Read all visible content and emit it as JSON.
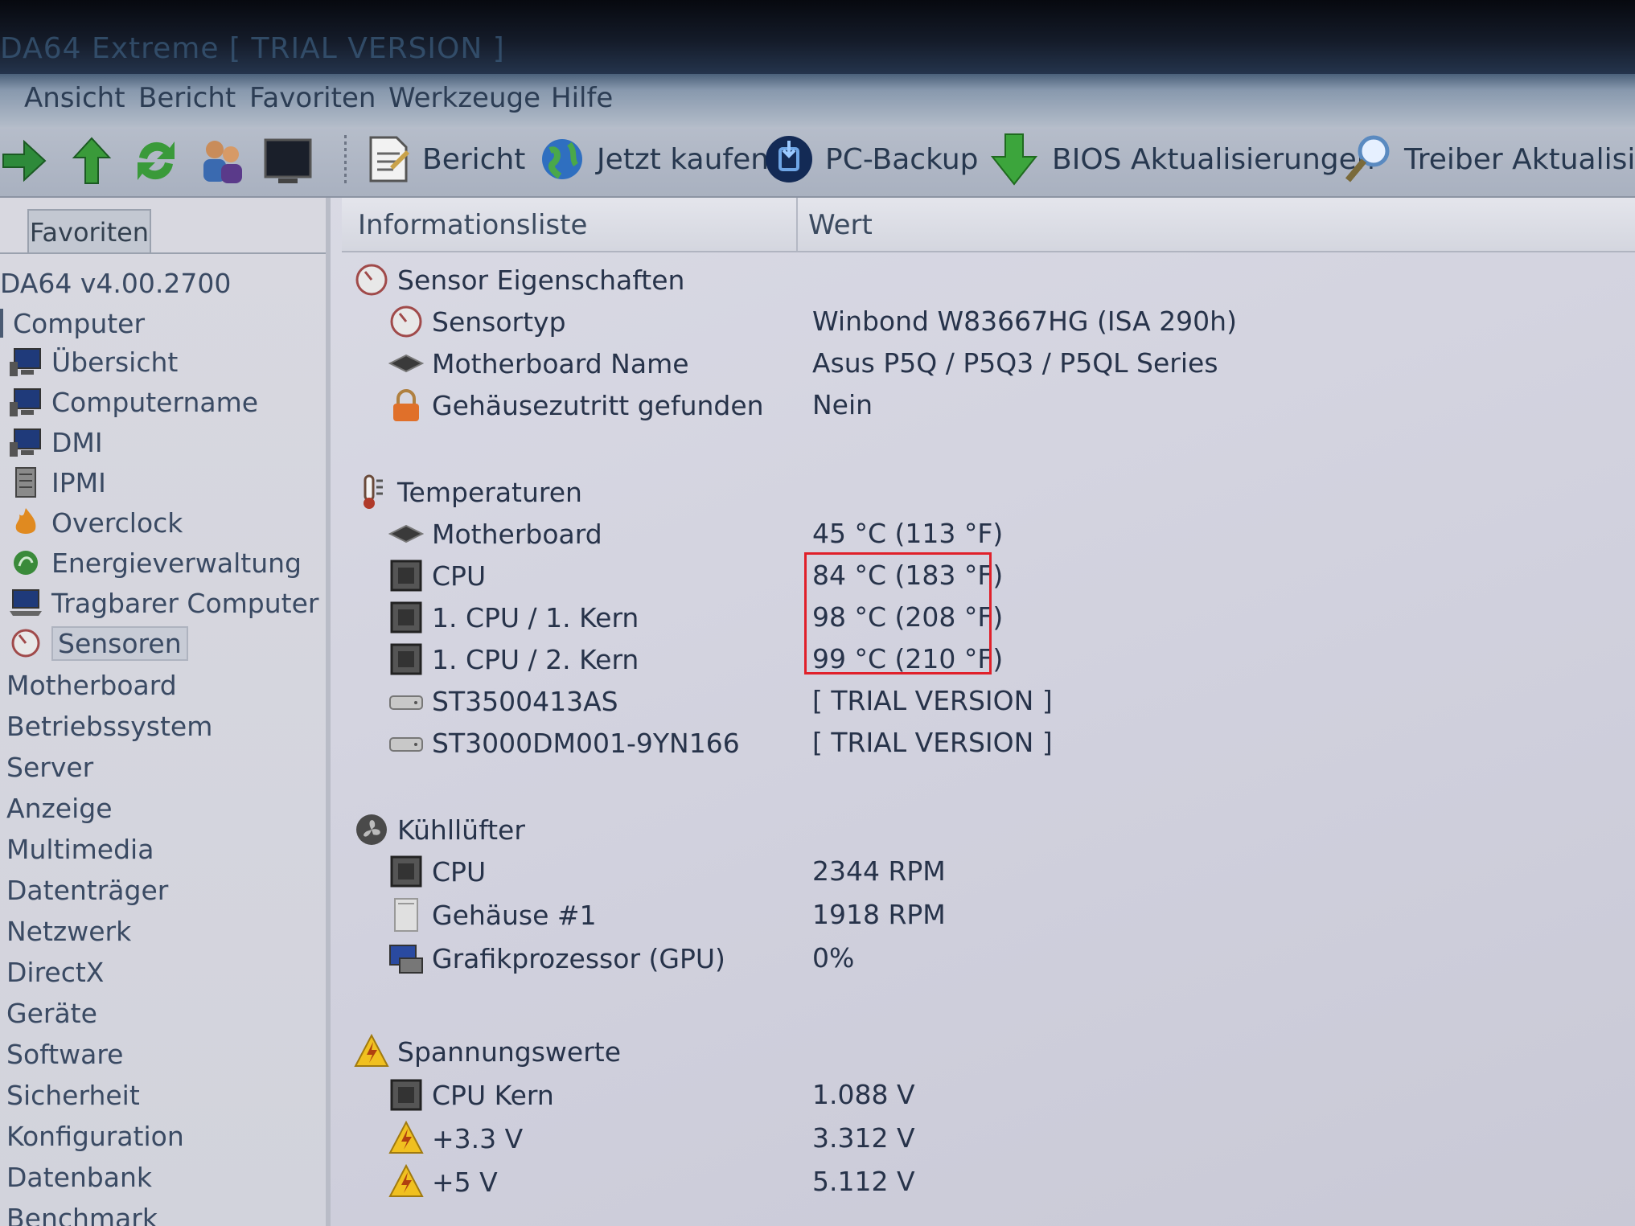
{
  "window": {
    "title": "DA64 Extreme  [ TRIAL VERSION ]"
  },
  "menu": [
    "Ansicht",
    "Bericht",
    "Favoriten",
    "Werkzeuge",
    "Hilfe"
  ],
  "toolbar": {
    "buttons": [
      "Bericht",
      "Jetzt kaufen",
      "PC-Backup",
      "BIOS Aktualisierungen",
      "Treiber Aktualisierun"
    ]
  },
  "sidebar": {
    "tab": "Favoriten",
    "version": "DA64 v4.00.2700",
    "items": [
      "Computer",
      "Übersicht",
      "Computername",
      "DMI",
      "IPMI",
      "Overclock",
      "Energieverwaltung",
      "Tragbarer Computer",
      "Sensoren",
      "Motherboard",
      "Betriebssystem",
      "Server",
      "Anzeige",
      "Multimedia",
      "Datenträger",
      "Netzwerk",
      "DirectX",
      "Geräte",
      "Software",
      "Sicherheit",
      "Konfiguration",
      "Datenbank",
      "Benchmark"
    ],
    "selected": "Sensoren"
  },
  "columns": {
    "info": "Informationsliste",
    "value": "Wert"
  },
  "sensor_props": {
    "title": "Sensor Eigenschaften",
    "rows": [
      {
        "label": "Sensortyp",
        "value": "Winbond W83667HG  (ISA 290h)"
      },
      {
        "label": "Motherboard Name",
        "value": "Asus P5Q / P5Q3 / P5QL Series"
      },
      {
        "label": "Gehäusezutritt gefunden",
        "value": "Nein"
      }
    ]
  },
  "temperatures": {
    "title": "Temperaturen",
    "rows": [
      {
        "label": "Motherboard",
        "value": "45 °C  (113 °F)"
      },
      {
        "label": "CPU",
        "value": "84 °C  (183 °F)"
      },
      {
        "label": "1. CPU / 1. Kern",
        "value": "98 °C  (208 °F)"
      },
      {
        "label": "1. CPU / 2. Kern",
        "value": "99 °C  (210 °F)"
      },
      {
        "label": "ST3500413AS",
        "value": "[ TRIAL VERSION ]"
      },
      {
        "label": "ST3000DM001-9YN166",
        "value": "[ TRIAL VERSION ]"
      }
    ]
  },
  "fans": {
    "title": "Kühllüfter",
    "rows": [
      {
        "label": "CPU",
        "value": "2344 RPM"
      },
      {
        "label": "Gehäuse #1",
        "value": "1918 RPM"
      },
      {
        "label": "Grafikprozessor (GPU)",
        "value": "0%"
      }
    ]
  },
  "voltages": {
    "title": "Spannungswerte",
    "rows": [
      {
        "label": "CPU Kern",
        "value": "1.088 V"
      },
      {
        "label": "+3.3 V",
        "value": "3.312 V"
      },
      {
        "label": "+5 V",
        "value": "5.112 V"
      }
    ]
  },
  "colors": {
    "highlight_box": "#e0202a",
    "text": "#27334a"
  }
}
